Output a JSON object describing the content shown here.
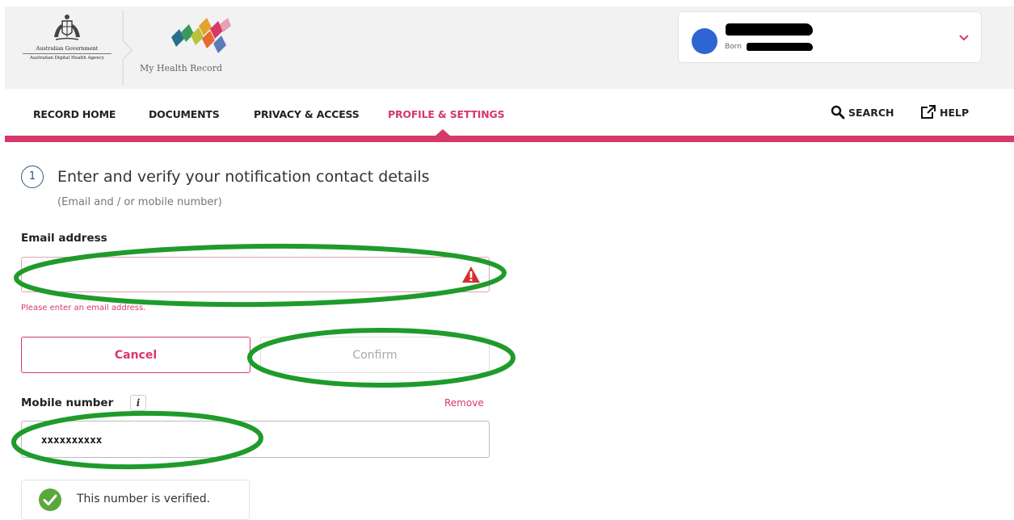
{
  "header": {
    "gov_line1": "Australian Government",
    "gov_line2": "Australian Digital Health Agency",
    "app_name": "My Health Record",
    "profile": {
      "born_label": "Born"
    }
  },
  "nav": {
    "items": [
      {
        "label": "RECORD HOME"
      },
      {
        "label": "DOCUMENTS"
      },
      {
        "label": "PRIVACY & ACCESS"
      },
      {
        "label": "PROFILE & SETTINGS"
      }
    ],
    "active_index": 3,
    "search_label": "SEARCH",
    "help_label": "HELP"
  },
  "form": {
    "step_number": "1",
    "title": "Enter and verify your notification contact details",
    "subtitle": "(Email and / or mobile number)",
    "email_label": "Email address",
    "email_value": "",
    "email_error": "Please enter an email address.",
    "cancel_label": "Cancel",
    "confirm_label": "Confirm",
    "mobile_label": "Mobile number",
    "info_glyph": "i",
    "remove_label": "Remove",
    "mobile_value": "xxxxxxxxxx",
    "verified_text": "This number is verified."
  },
  "colors": {
    "accent": "#d63867",
    "annotation": "#1f9b2c",
    "avatar": "#2f64d3",
    "verified": "#5aa83b"
  }
}
